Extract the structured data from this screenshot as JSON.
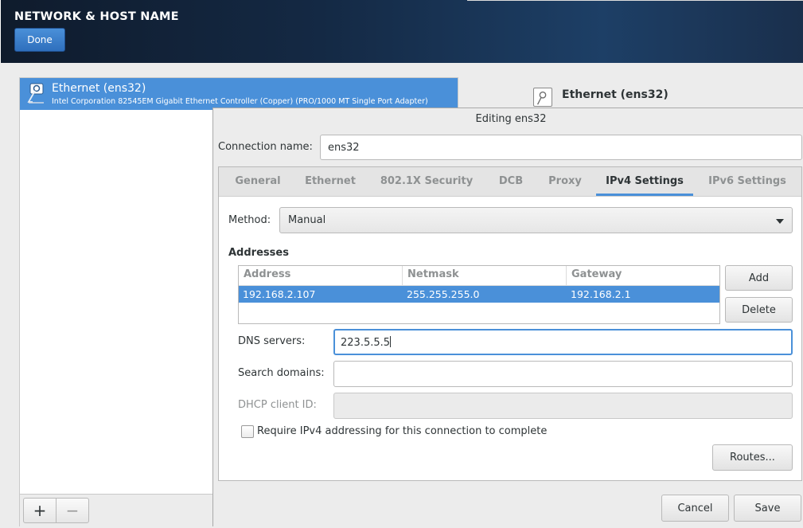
{
  "header": {
    "title": "NETWORK & HOST NAME",
    "done_label": "Done"
  },
  "device_list": {
    "items": [
      {
        "name": "Ethernet (ens32)",
        "description": "Intel Corporation 82545EM Gigabit Ethernet Controller (Copper) (PRO/1000 MT Single Port Adapter)",
        "icon": "ethernet-cable-icon",
        "selected": true
      }
    ],
    "add_label": "+",
    "remove_label": "−"
  },
  "details": {
    "title": "Ethernet (ens32)",
    "icon": "ethernet-cable-icon"
  },
  "dialog": {
    "title": "Editing ens32",
    "connection_name_label": "Connection name:",
    "connection_name_value": "ens32",
    "tabs": [
      {
        "label": "General",
        "active": false
      },
      {
        "label": "Ethernet",
        "active": false
      },
      {
        "label": "802.1X Security",
        "active": false
      },
      {
        "label": "DCB",
        "active": false
      },
      {
        "label": "Proxy",
        "active": false
      },
      {
        "label": "IPv4 Settings",
        "active": true
      },
      {
        "label": "IPv6 Settings",
        "active": false
      }
    ],
    "ipv4": {
      "method_label": "Method:",
      "method_value": "Manual",
      "addresses_heading": "Addresses",
      "columns": [
        "Address",
        "Netmask",
        "Gateway"
      ],
      "rows": [
        {
          "address": "192.168.2.107",
          "netmask": "255.255.255.0",
          "gateway": "192.168.2.1",
          "selected": true
        }
      ],
      "add_label": "Add",
      "delete_label": "Delete",
      "dns_label": "DNS servers:",
      "dns_value": "223.5.5.5",
      "search_label": "Search domains:",
      "search_value": "",
      "dhcp_label": "DHCP client ID:",
      "dhcp_value": "",
      "require_label": "Require IPv4 addressing for this connection to complete",
      "require_checked": false,
      "routes_label": "Routes..."
    },
    "cancel_label": "Cancel",
    "save_label": "Save"
  },
  "colors": {
    "accent": "#4a90d9",
    "header_bg": "#142944"
  }
}
